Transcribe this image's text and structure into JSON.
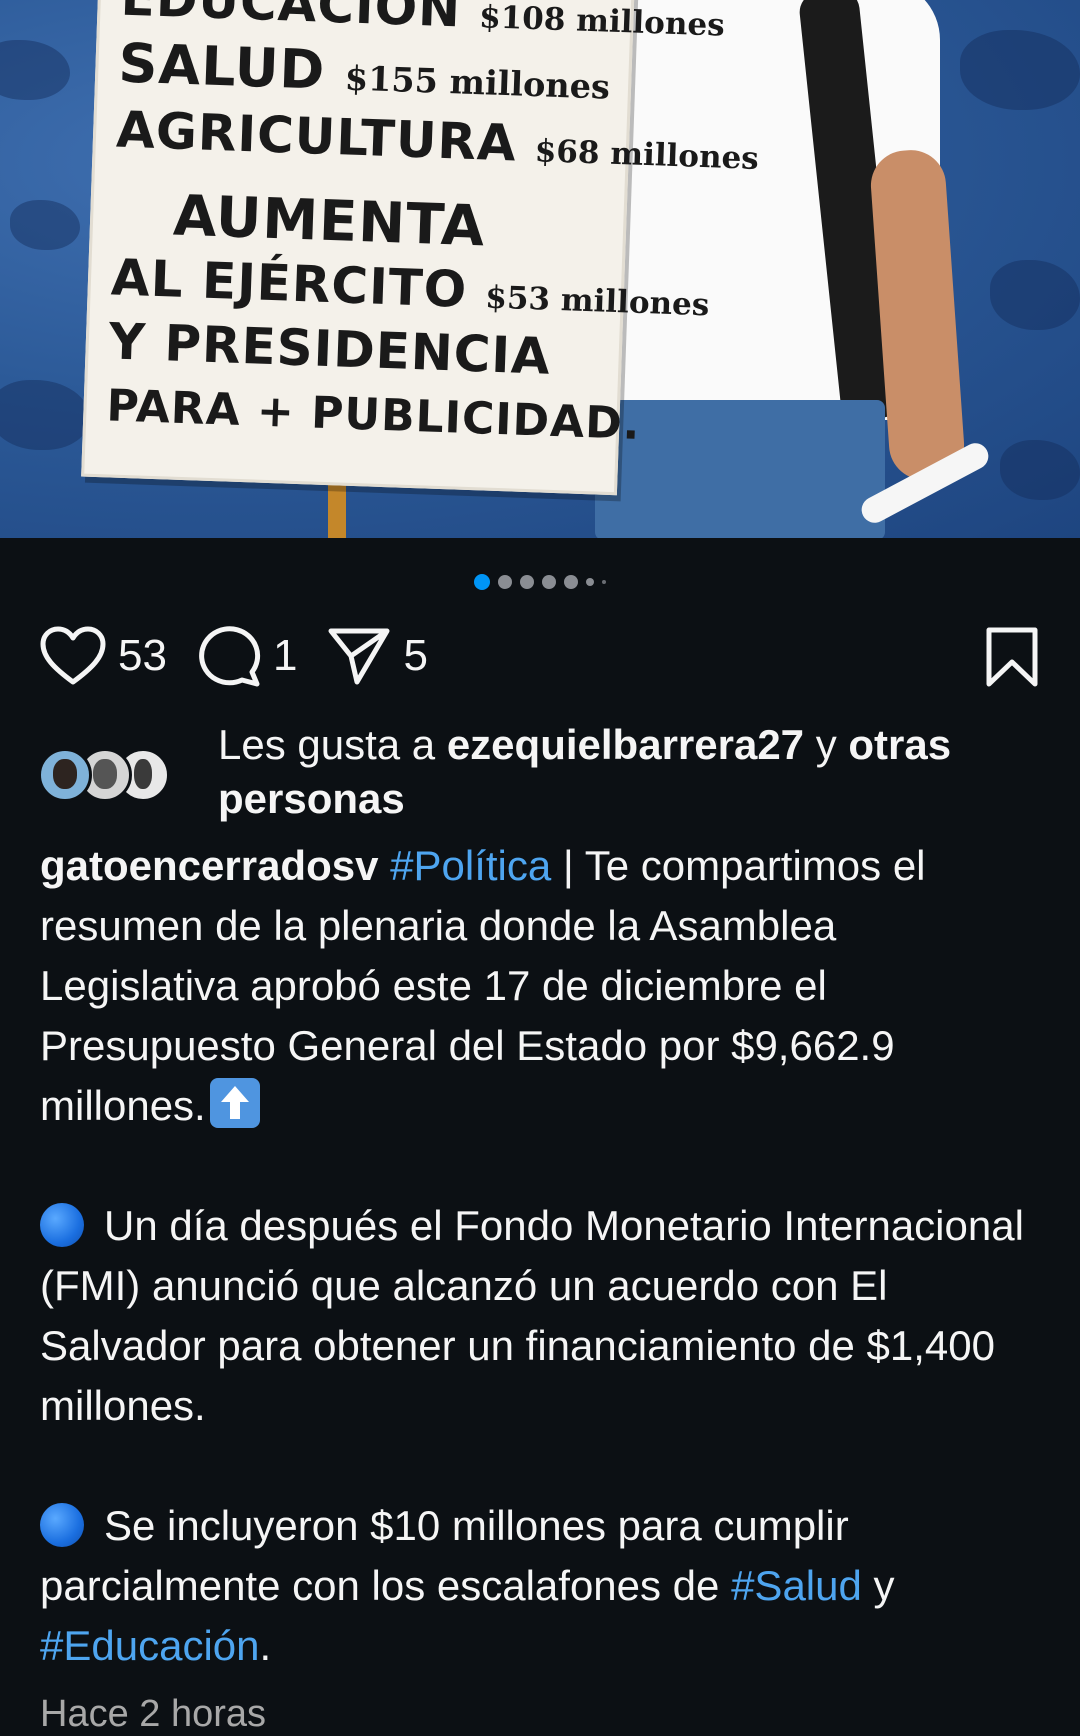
{
  "photo": {
    "sign_lines": [
      {
        "word": "EDUCACIÓN",
        "amount": "$108 millones"
      },
      {
        "word": "SALUD",
        "amount": "$155 millones"
      },
      {
        "word": "AGRICULTURA",
        "amount": "$68 millones"
      },
      {
        "word": "AUMENTA",
        "amount": ""
      },
      {
        "word": "AL EJÉRCITO",
        "amount": "$53 millones"
      },
      {
        "word": "Y PRESIDENCIA",
        "amount": ""
      },
      {
        "word": "PARA + PUBLICIDAD.",
        "amount": ""
      }
    ]
  },
  "carousel": {
    "slide_count": 7,
    "active_index": 0
  },
  "actions": {
    "likes_count": "53",
    "comments_count": "1",
    "shares_count": "5",
    "icons": [
      "heart-icon",
      "comment-icon",
      "share-icon",
      "bookmark-icon"
    ]
  },
  "likes": {
    "prefix": "Les gusta a ",
    "user": "ezequielbarrera27",
    "middle": " y ",
    "others": "otras personas"
  },
  "caption": {
    "username": "gatoencerradosv",
    "hashtag1": "#Política",
    "para1": " | Te compartimos el resumen de la plenaria donde la Asamblea Legislativa aprobó este 17 de diciembre el Presupuesto General del Estado por $9,662.9 millones.",
    "para2": "Un día después el Fondo Monetario Internacional (FMI) anunció que alcanzó un acuerdo con El Salvador para obtener un financiamiento de $1,400 millones.",
    "para3_start": "Se incluyeron $10 millones para cumplir parcialmente con los escalafones de ",
    "hashtag2": "#Salud",
    "para3_mid": " y ",
    "hashtag3": "#Educación",
    "para3_end": "."
  },
  "timestamp": "Hace 2 horas",
  "colors": {
    "background": "#0c1014",
    "hashtag": "#4ea5f0",
    "active_dot": "#0095f6"
  }
}
